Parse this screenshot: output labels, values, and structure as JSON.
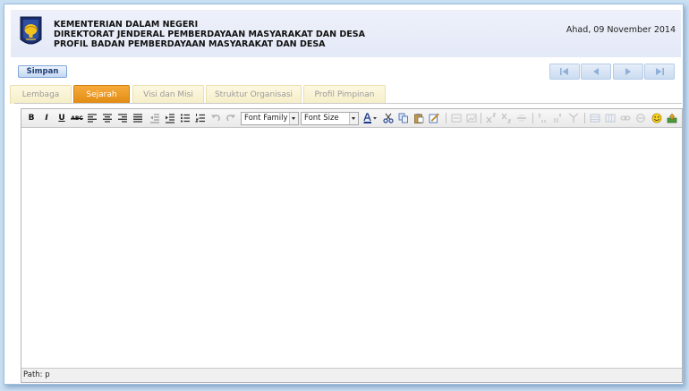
{
  "header": {
    "org_line1": "KEMENTERIAN DALAM NEGERI",
    "org_line2": "DIREKTORAT JENDERAL PEMBERDAYAAN MASYARAKAT DAN DESA",
    "org_line3": "PROFIL BADAN PEMBERDAYAAN MASYARAKAT DAN DESA",
    "date": "Ahad, 09 November 2014",
    "logo_icon": "garuda-emblem-icon"
  },
  "actions": {
    "save_label": "Simpan"
  },
  "nav_buttons": [
    "first-record-icon",
    "previous-record-icon",
    "next-record-icon",
    "last-record-icon"
  ],
  "tabs": [
    {
      "label": "Lembaga",
      "active": false
    },
    {
      "label": "Sejarah",
      "active": true
    },
    {
      "label": "Visi dan Misi",
      "active": false
    },
    {
      "label": "Struktur Organisasi",
      "active": false
    },
    {
      "label": "Profil Pimpinan",
      "active": false
    }
  ],
  "editor": {
    "bold_label": "B",
    "italic_label": "I",
    "underline_label": "U",
    "strike_label": "ABC",
    "font_family_value": "Font Family",
    "font_size_value": "Font Size",
    "status_path": "Path: p",
    "content": ""
  },
  "colors": {
    "active_tab": "#e8921c",
    "inactive_tab": "#f8f0cc",
    "header_bg": "#e6ebf8",
    "page_bg": "#c9dff2"
  }
}
